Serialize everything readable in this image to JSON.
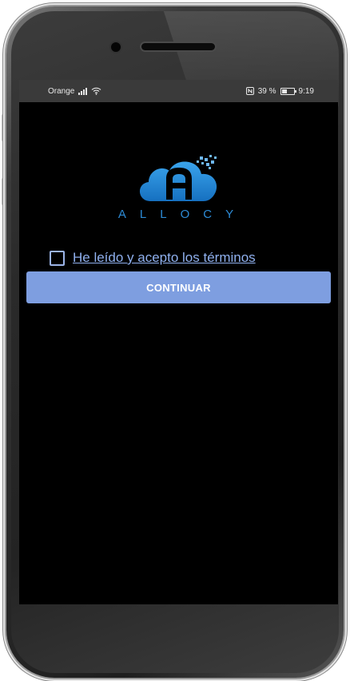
{
  "status_bar": {
    "carrier": "Orange",
    "battery_text": "39 %",
    "time": "9:19",
    "icons": [
      "signal-icon",
      "wifi-icon",
      "nfc-icon",
      "battery-icon"
    ]
  },
  "app": {
    "brand_name": "ALLOCY",
    "logo_icon": "cloud-a-logo",
    "accent_color": "#2d8bd6",
    "terms_label": "He leído y acepto los términos",
    "terms_checked": false,
    "continue_label": "CONTINUAR",
    "button_color": "#7e9ee0"
  }
}
